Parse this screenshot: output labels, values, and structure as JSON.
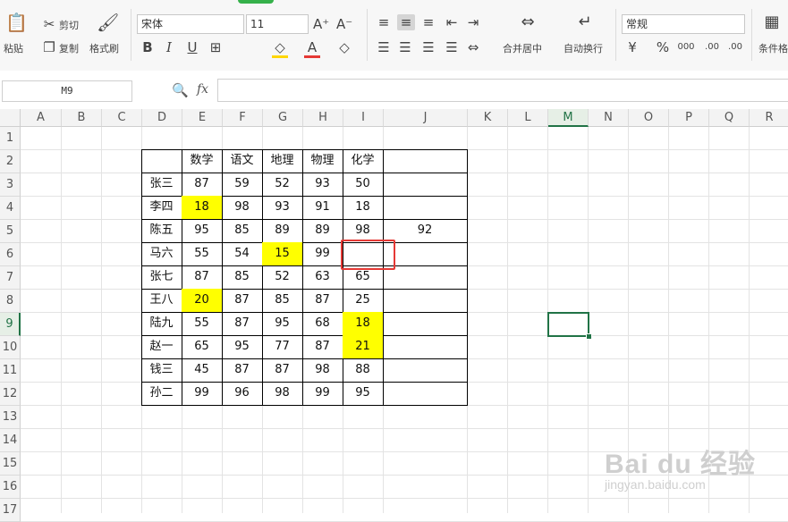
{
  "toolbar": {
    "paste": "粘贴",
    "cut": "剪切",
    "copy": "复制",
    "format_painter": "格式刷",
    "font_name": "宋体",
    "font_size": "11",
    "merge_center": "合并居中",
    "wrap_text": "自动换行",
    "number_format": "常规",
    "conditional_format": "条件格",
    "percent": "%",
    "thousands": "000",
    "dec_inc": ".00",
    "dec_dec": ".00"
  },
  "formula_bar": {
    "cell_name": "M9",
    "fx": "fx",
    "content": ""
  },
  "columns": [
    "A",
    "B",
    "C",
    "D",
    "E",
    "F",
    "G",
    "H",
    "I",
    "J",
    "K",
    "L",
    "M",
    "N",
    "O",
    "P",
    "Q",
    "R"
  ],
  "rows": [
    "1",
    "2",
    "3",
    "4",
    "5",
    "6",
    "7",
    "8",
    "9",
    "10",
    "11",
    "12",
    "13",
    "14",
    "15",
    "16",
    "17"
  ],
  "table": {
    "headers": [
      "",
      "数学",
      "语文",
      "地理",
      "物理",
      "化学",
      ""
    ],
    "names": [
      "张三",
      "李四",
      "陈五",
      "马六",
      "张七",
      "王八",
      "陆九",
      "赵一",
      "钱三",
      "孙二"
    ],
    "scores": [
      [
        "87",
        "59",
        "52",
        "93",
        "50",
        ""
      ],
      [
        "18",
        "98",
        "93",
        "91",
        "18",
        ""
      ],
      [
        "95",
        "85",
        "89",
        "89",
        "98",
        "92"
      ],
      [
        "55",
        "54",
        "15",
        "99",
        "",
        ""
      ],
      [
        "87",
        "85",
        "52",
        "63",
        "65",
        ""
      ],
      [
        "20",
        "87",
        "85",
        "87",
        "25",
        ""
      ],
      [
        "55",
        "87",
        "95",
        "68",
        "18",
        ""
      ],
      [
        "65",
        "95",
        "77",
        "87",
        "21",
        ""
      ],
      [
        "45",
        "87",
        "87",
        "98",
        "88",
        ""
      ],
      [
        "99",
        "96",
        "98",
        "99",
        "95",
        ""
      ]
    ],
    "highlight_color": "#ffff00",
    "highlighted_cells": [
      [
        1,
        0
      ],
      [
        3,
        2
      ],
      [
        5,
        0
      ],
      [
        6,
        4
      ],
      [
        7,
        4
      ]
    ]
  },
  "selection": {
    "active_cell": "M9",
    "color": "#217346"
  },
  "marker": {
    "cell": "I6",
    "color": "#e53935"
  },
  "watermark": {
    "main": "Bai du 经验",
    "sub": "jingyan.baidu.com"
  }
}
